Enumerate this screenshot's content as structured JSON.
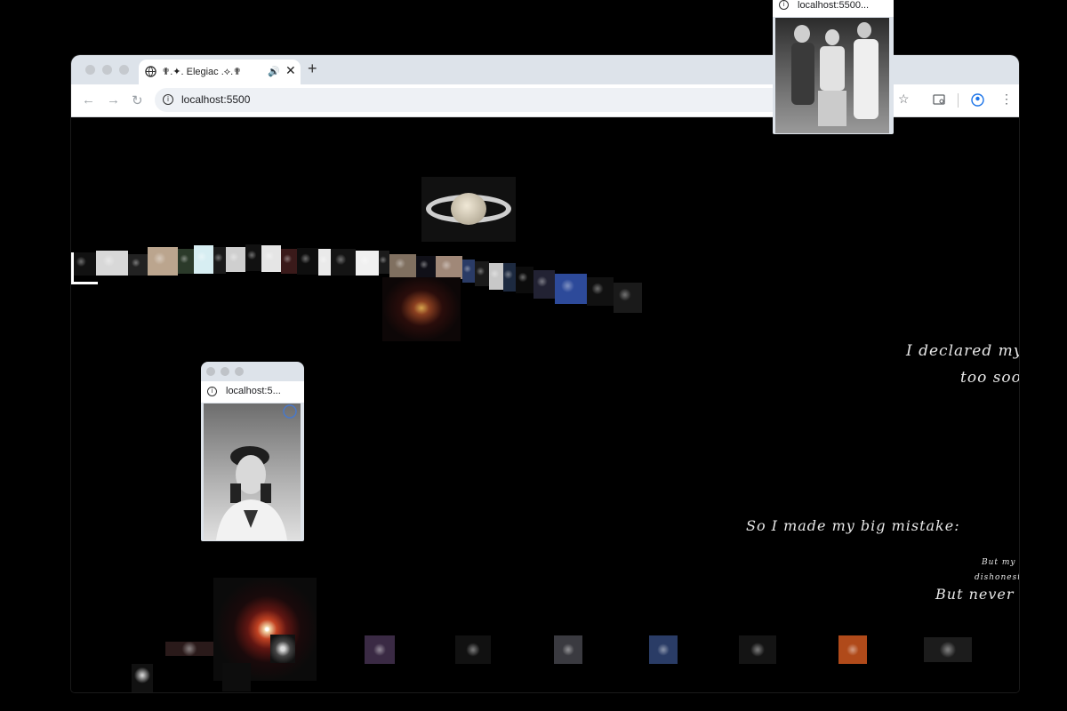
{
  "browser": {
    "tab_title": "✟.✦. Elegiac .⟡.✟",
    "new_tab_label": "+",
    "close_label": "✕",
    "url": "localhost:5500",
    "back_label": "←",
    "forward_label": "→",
    "reload_label": "↻",
    "info_label": "i",
    "star_label": "☆",
    "menu_label": "⋮"
  },
  "lyrics": {
    "line1": "I declared my",
    "line2": "too soo",
    "line3": "So I made my big mistake:",
    "line4": "But my",
    "line5": "dishonest",
    "line6": "But never"
  },
  "mini_window_top": {
    "url": "localhost:5500..."
  },
  "mini_window_left": {
    "url": "localhost:5..."
  },
  "colors": {
    "background": "#000000",
    "text": "#e8e8e8",
    "chrome": "#dde3ea"
  }
}
